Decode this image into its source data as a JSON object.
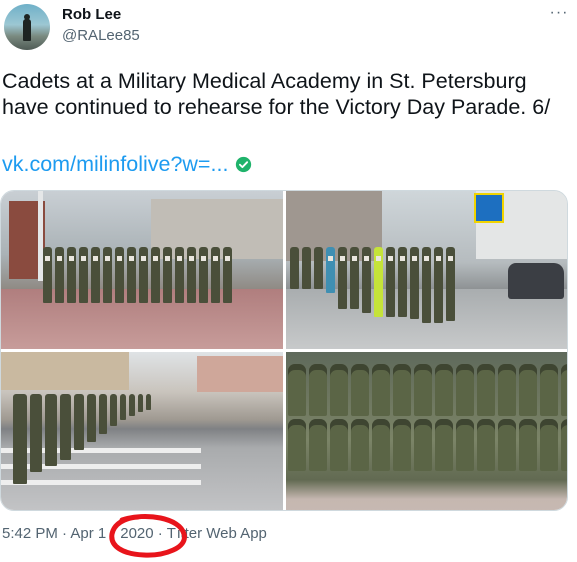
{
  "author": {
    "display_name": "Rob Lee",
    "handle": "@RALee85",
    "avatar_icon": "person-silhouette-avatar"
  },
  "more_icon": "ellipsis-icon",
  "more_label": "···",
  "tweet_text": "Cadets at a Military Medical Academy in St. Petersburg have continued to rehearse for the Victory Day Parade. 6/",
  "link": {
    "text": "vk.com/milinfolive?w=...",
    "icon": "verified-check-icon",
    "color": "#1d9bf0"
  },
  "media": {
    "photos": [
      {
        "subject": "cadets-marching-plaza"
      },
      {
        "subject": "cadets-marching-street"
      },
      {
        "subject": "cadets-crossing-road"
      },
      {
        "subject": "cadets-close-formation"
      }
    ]
  },
  "meta": {
    "time": "5:42 PM",
    "separator": " · ",
    "date_part": "Apr 1",
    "year": "2020",
    "source": "Twitter Web App",
    "source_visible": "T itter Web App"
  },
  "annotation": {
    "shape": "hand-drawn-circle",
    "color": "#e8141b"
  },
  "colors": {
    "text": "#0f1419",
    "secondary": "#536471",
    "accent": "#1d9bf0",
    "border": "#cfd9de"
  }
}
